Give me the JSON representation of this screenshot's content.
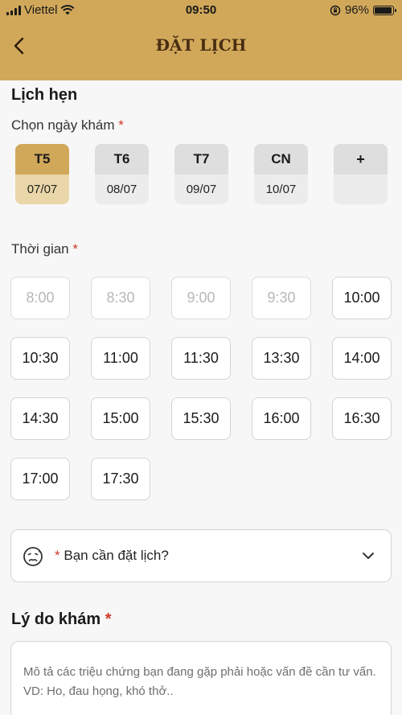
{
  "status_bar": {
    "carrier": "Viettel",
    "time": "09:50",
    "battery_percent": "96%",
    "battery_level": 0.96,
    "icons": [
      "signal-icon",
      "wifi-icon",
      "orientation-lock-icon",
      "battery-icon"
    ]
  },
  "header": {
    "title": "ĐẶT LỊCH",
    "back_icon": "chevron-left-icon",
    "background_color": "#d1a85a"
  },
  "booking": {
    "section_title": "Lịch hẹn",
    "date_label": "Chọn ngày khám",
    "required_mark": "*",
    "dates": [
      {
        "day": "T5",
        "date": "07/07",
        "selected": true
      },
      {
        "day": "T6",
        "date": "08/07",
        "selected": false
      },
      {
        "day": "T7",
        "date": "09/07",
        "selected": false
      },
      {
        "day": "CN",
        "date": "10/07",
        "selected": false
      },
      {
        "day": "+",
        "date": "",
        "selected": false
      }
    ],
    "time_label": "Thời gian",
    "times": [
      {
        "label": "8:00",
        "disabled": true
      },
      {
        "label": "8:30",
        "disabled": true
      },
      {
        "label": "9:00",
        "disabled": true
      },
      {
        "label": "9:30",
        "disabled": true
      },
      {
        "label": "10:00",
        "disabled": false
      },
      {
        "label": "10:30",
        "disabled": false
      },
      {
        "label": "11:00",
        "disabled": false
      },
      {
        "label": "11:30",
        "disabled": false
      },
      {
        "label": "13:30",
        "disabled": false
      },
      {
        "label": "14:00",
        "disabled": false
      },
      {
        "label": "14:30",
        "disabled": false
      },
      {
        "label": "15:00",
        "disabled": false
      },
      {
        "label": "15:30",
        "disabled": false
      },
      {
        "label": "16:00",
        "disabled": false
      },
      {
        "label": "16:30",
        "disabled": false
      },
      {
        "label": "17:00",
        "disabled": false
      },
      {
        "label": "17:30",
        "disabled": false
      }
    ],
    "booking_for": {
      "required_mark": "*",
      "placeholder": "Bạn cần đặt lịch?",
      "icon": "sick-face-icon",
      "dropdown_icon": "chevron-down-icon"
    }
  },
  "reason": {
    "title": "Lý do khám",
    "required_mark": "*",
    "placeholder": "Mô tả các triệu chứng bạn đang gặp phải hoặc vấn đề cần tư vấn. VD: Ho, đau họng, khó thở.."
  },
  "colors": {
    "accent": "#d1a85a",
    "selected_date_bg": "#ead7a9",
    "required": "#d0392b"
  }
}
